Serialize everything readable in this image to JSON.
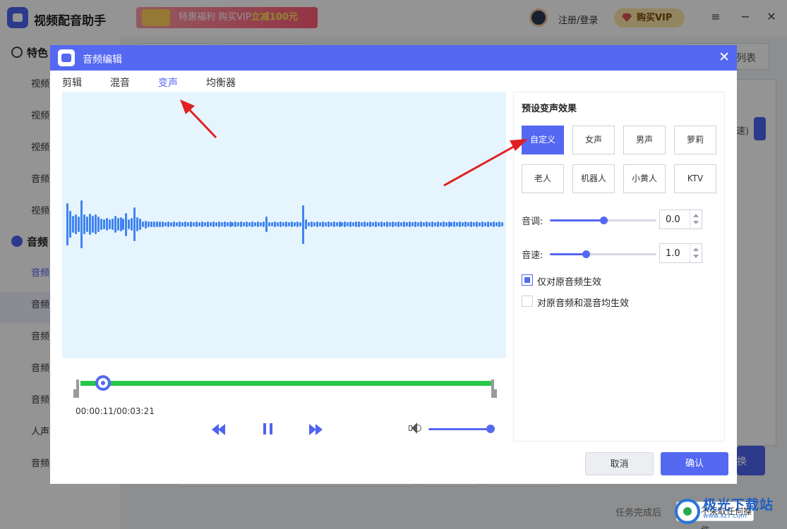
{
  "app": {
    "name": "视频配音助手",
    "promo_text": "特惠福利 购买VIP",
    "promo_em": "立减100元",
    "login": "注册/登录",
    "buy_vip": "购买VIP",
    "minimize": "−",
    "menu": "≡",
    "close": "✕"
  },
  "sidebar": {
    "section_special": "特色",
    "section_audio": "音频",
    "items_top": [
      "视频",
      "视频",
      "视频",
      "音频",
      "视频"
    ],
    "items_audio": [
      "音频",
      "音频",
      "音频",
      "音频",
      "音频",
      "人声",
      "音频"
    ]
  },
  "main_bg": {
    "list_btn": "列表",
    "speed_text": "速)",
    "convert_btn": "换",
    "task_label": "任务完成后",
    "task_value": "不采取任何操作"
  },
  "dialog": {
    "title": "音频编辑",
    "close": "✕",
    "tabs": [
      "剪辑",
      "混音",
      "变声",
      "均衡器"
    ],
    "active_tab": "变声",
    "time": "00:00:11/00:03:21",
    "playback_fraction": 0.055,
    "volume_fraction": 1.0,
    "cancel": "取消",
    "confirm": "确认"
  },
  "voice_panel": {
    "title": "预设变声效果",
    "presets": [
      "自定义",
      "女声",
      "男声",
      "萝莉",
      "老人",
      "机器人",
      "小黄人",
      "KTV"
    ],
    "selected_preset": "自定义",
    "pitch_label": "音调:",
    "pitch_value": "0.0",
    "pitch_fraction": 0.5,
    "speed_label": "音速:",
    "speed_value": "1.0",
    "speed_fraction": 0.34,
    "option1": "仅对原音频生效",
    "option1_checked": true,
    "option2": "对原音频和混音均生效",
    "option2_checked": false
  },
  "watermark": {
    "text": "极光下载站",
    "sub": "www.xz7.com"
  },
  "colors": {
    "accent": "#5568f2",
    "wave": "#3f84f0",
    "trim": "#25c84a",
    "arrow": "#e02020"
  },
  "waveform": [
    0.55,
    0.34,
    0.22,
    0.26,
    0.2,
    0.62,
    0.26,
    0.2,
    0.28,
    0.22,
    0.26,
    0.2,
    0.14,
    0.12,
    0.16,
    0.12,
    0.14,
    0.22,
    0.16,
    0.18,
    0.14,
    0.3,
    0.12,
    0.16,
    0.44,
    0.18,
    0.14,
    0.08,
    0.1,
    0.07,
    0.08,
    0.07,
    0.08,
    0.07,
    0.07,
    0.06,
    0.07,
    0.06,
    0.07,
    0.06,
    0.07,
    0.06,
    0.07,
    0.06,
    0.07,
    0.06,
    0.07,
    0.06,
    0.07,
    0.06,
    0.07,
    0.06,
    0.07,
    0.06,
    0.07,
    0.06,
    0.07,
    0.06,
    0.07,
    0.06,
    0.07,
    0.06,
    0.07,
    0.06,
    0.07,
    0.06,
    0.07,
    0.06,
    0.07,
    0.06,
    0.07,
    0.2,
    0.06,
    0.06,
    0.07,
    0.06,
    0.07,
    0.06,
    0.07,
    0.06,
    0.07,
    0.06,
    0.07,
    0.06,
    0.5,
    0.12,
    0.06,
    0.07,
    0.06,
    0.07,
    0.06,
    0.07,
    0.06,
    0.07,
    0.06,
    0.07,
    0.06,
    0.07,
    0.06,
    0.07,
    0.06,
    0.07,
    0.06,
    0.07,
    0.08,
    0.06,
    0.07,
    0.06,
    0.07,
    0.06,
    0.07,
    0.06,
    0.07,
    0.06,
    0.07,
    0.06,
    0.07,
    0.06,
    0.07,
    0.06,
    0.07,
    0.06,
    0.07,
    0.06,
    0.07,
    0.06,
    0.07,
    0.06,
    0.07,
    0.06,
    0.07,
    0.06,
    0.07,
    0.06,
    0.07,
    0.06,
    0.07,
    0.06,
    0.07,
    0.06,
    0.07,
    0.06,
    0.07,
    0.06,
    0.07,
    0.06,
    0.07,
    0.06,
    0.07,
    0.06,
    0.07,
    0.06,
    0.07,
    0.06,
    0.07,
    0.06
  ]
}
